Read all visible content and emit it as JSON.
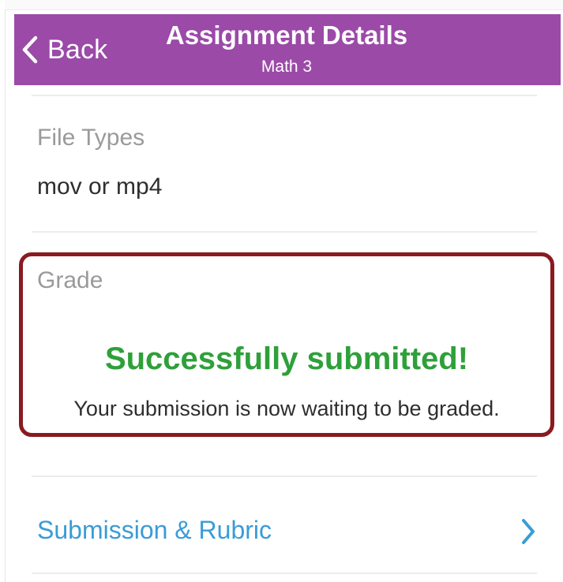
{
  "header": {
    "back_label": "Back",
    "title": "Assignment Details",
    "subtitle": "Math 3",
    "background_color": "#9b4aa8"
  },
  "file_types": {
    "label": "File Types",
    "value": "mov or mp4"
  },
  "grade": {
    "label": "Grade",
    "status": "Successfully submitted!",
    "message": "Your submission is now waiting to be graded.",
    "status_color": "#2ea03a",
    "highlight_border_color": "#8a1a1f"
  },
  "submission_link": {
    "label": "Submission & Rubric",
    "icon": "chevron-right-icon",
    "color": "#3a9cd6"
  }
}
